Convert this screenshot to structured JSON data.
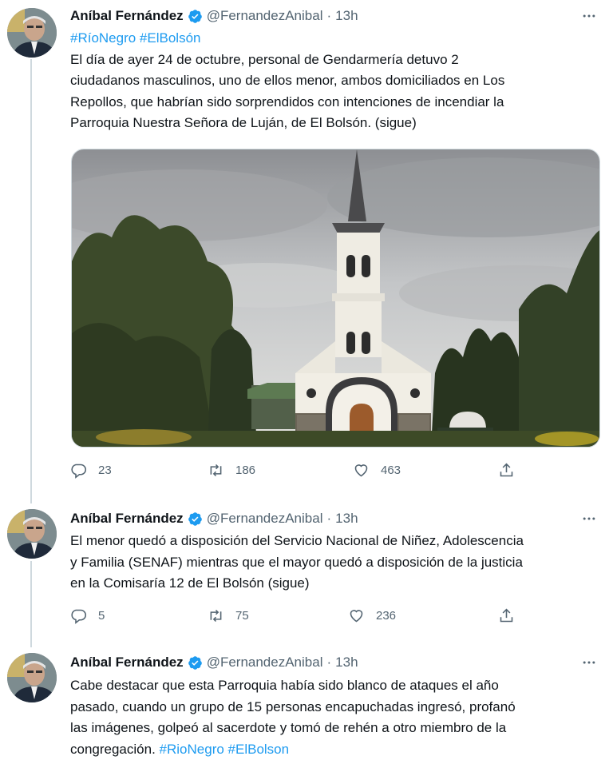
{
  "tweets": [
    {
      "author": {
        "name": "Aníbal Fernández",
        "handle": "@FernandezAnibal",
        "time": "13h"
      },
      "hashtags_line": "#RíoNegro #ElBolsón",
      "lines": [
        "El día de ayer 24 de octubre, personal de Gendarmería detuvo 2",
        "ciudadanos masculinos, uno de ellos menor, ambos domiciliados en Los",
        "Repollos, que habrían sido sorprendidos con intenciones de incendiar la",
        "Parroquia Nuestra Señora de Luján, de El Bolsón. (sigue)"
      ],
      "media": {
        "type": "photo",
        "subject": "church-photo"
      },
      "stats": {
        "replies": "23",
        "retweets": "186",
        "likes": "463"
      }
    },
    {
      "author": {
        "name": "Aníbal Fernández",
        "handle": "@FernandezAnibal",
        "time": "13h"
      },
      "lines": [
        "El menor quedó a disposición del Servicio Nacional de Niñez, Adolescencia",
        "y Familia (SENAF) mientras que el mayor quedó a disposición de la justicia",
        "en la Comisaría 12 de El Bolsón (sigue)"
      ],
      "stats": {
        "replies": "5",
        "retweets": "75",
        "likes": "236"
      }
    },
    {
      "author": {
        "name": "Aníbal Fernández",
        "handle": "@FernandezAnibal",
        "time": "13h"
      },
      "lines": [
        "Cabe destacar que esta Parroquia había sido blanco de ataques el año",
        "pasado, cuando un grupo de 15 personas encapuchadas ingresó, profanó",
        "las imágenes, golpeó al sacerdote y tomó de rehén a otro miembro de la"
      ],
      "last_line_text": "congregación.",
      "last_line_hashtags": "#RioNegro #ElBolson"
    }
  ],
  "ui": {
    "header_separator": "·",
    "icons": [
      "verified-badge-icon",
      "more-options-icon",
      "reply-icon",
      "retweet-icon",
      "like-icon",
      "share-icon"
    ],
    "colors": {
      "link": "#1d9bf0",
      "secondary": "#536471",
      "verified": "#1d9bf0",
      "divider": "#cfd9de"
    }
  }
}
